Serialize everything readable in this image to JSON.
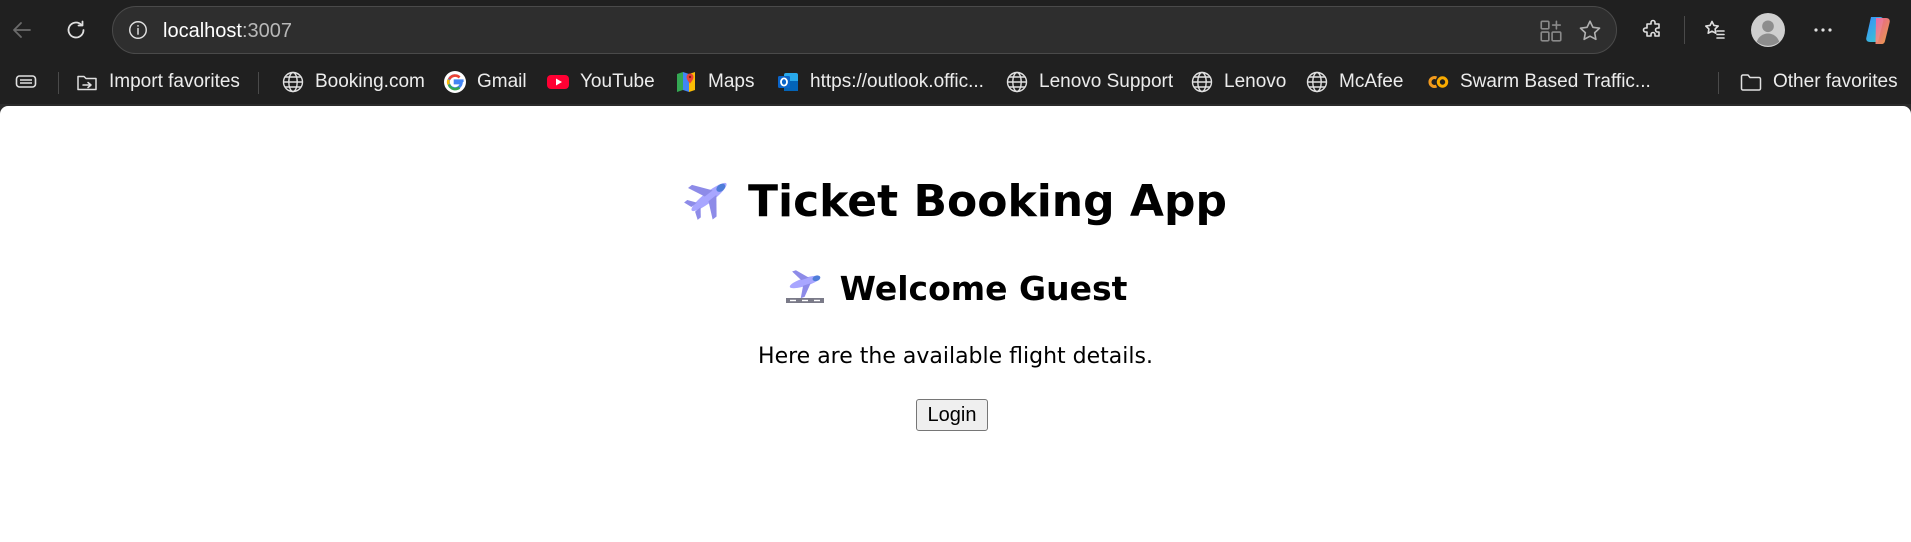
{
  "browser": {
    "address": {
      "host": "localhost",
      "port": ":3007"
    },
    "toolbar_icons": {
      "back": "back-arrow-icon",
      "refresh": "refresh-icon",
      "site_info": "info-icon",
      "app_available": "app-available-icon",
      "favorite": "star-icon",
      "extensions": "puzzle-icon",
      "favorites_list": "favorites-icon",
      "profile": "profile-avatar-icon",
      "more": "more-icon",
      "copilot": "copilot-icon"
    },
    "bookmarks": {
      "import_favorites": "Import favorites",
      "items": [
        "Booking.com",
        "Gmail",
        "YouTube",
        "Maps",
        "https://outlook.offic...",
        "Lenovo Support",
        "Lenovo",
        "McAfee",
        "Swarm Based Traffic..."
      ],
      "other_favorites": "Other favorites"
    }
  },
  "app": {
    "title_emoji": "✈️",
    "title": "Ticket Booking App",
    "welcome_emoji": "🛬",
    "welcome": "Welcome Guest",
    "subtitle": "Here are the available flight details.",
    "login_label": "Login"
  },
  "colors": {
    "browser_bg": "#202020",
    "omnibox_bg": "#2e2e2e",
    "page_bg": "#ffffff",
    "youtube_red": "#ff0033",
    "outlook_blue": "#0a64c9",
    "swarm_orange": "#f29a1d"
  }
}
